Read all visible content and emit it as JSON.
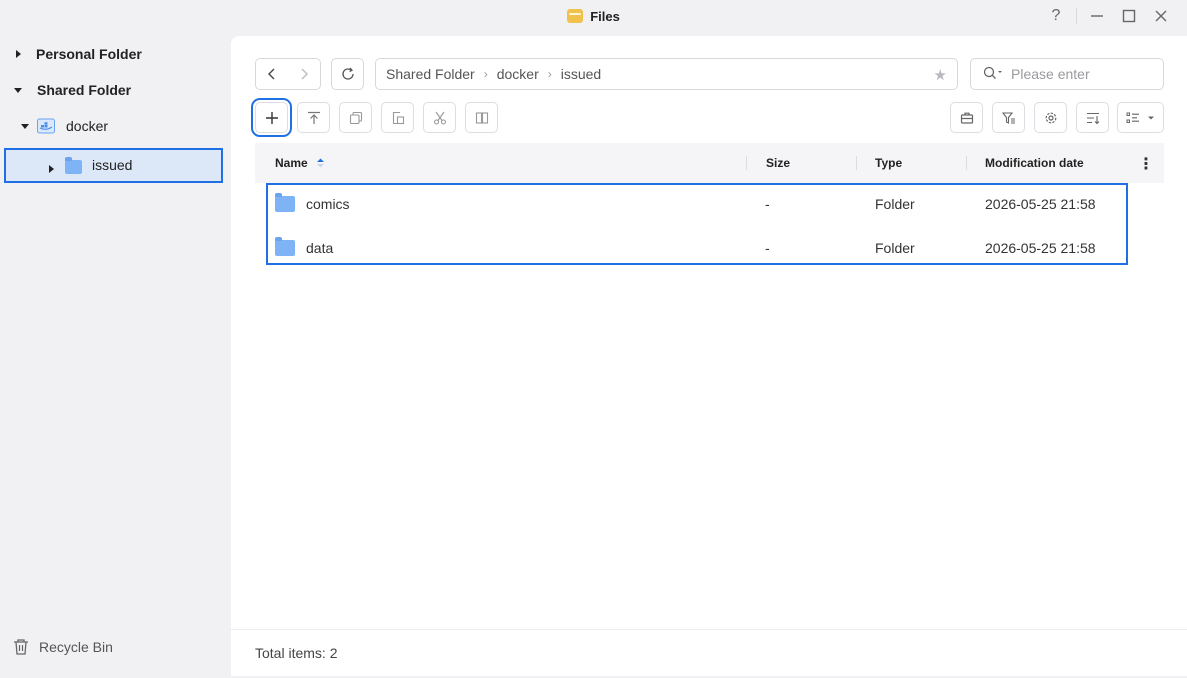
{
  "window": {
    "title": "Files",
    "help": "?",
    "minimize": "—",
    "maximize": "☐",
    "close": "✕"
  },
  "sidebar": {
    "personal": "Personal Folder",
    "shared": "Shared Folder",
    "docker": "docker",
    "issued": "issued",
    "recycle": "Recycle Bin"
  },
  "nav": {
    "back": "‹",
    "forward": "›",
    "refresh": "⟳"
  },
  "breadcrumb": [
    "Shared Folder",
    "docker",
    "issued"
  ],
  "search": {
    "placeholder": "Please enter"
  },
  "table": {
    "headers": {
      "name": "Name",
      "size": "Size",
      "type": "Type",
      "date": "Modification date"
    },
    "rows": [
      {
        "name": "comics",
        "size": "-",
        "type": "Folder",
        "date": "2026-05-25 21:58"
      },
      {
        "name": "data",
        "size": "-",
        "type": "Folder",
        "date": "2026-05-25 21:58"
      }
    ]
  },
  "footer": {
    "total": "Total items: 2"
  },
  "colors": {
    "accent": "#1f6fe5",
    "folder": "#7eb4f6",
    "selected_bg": "#dce7f7"
  }
}
